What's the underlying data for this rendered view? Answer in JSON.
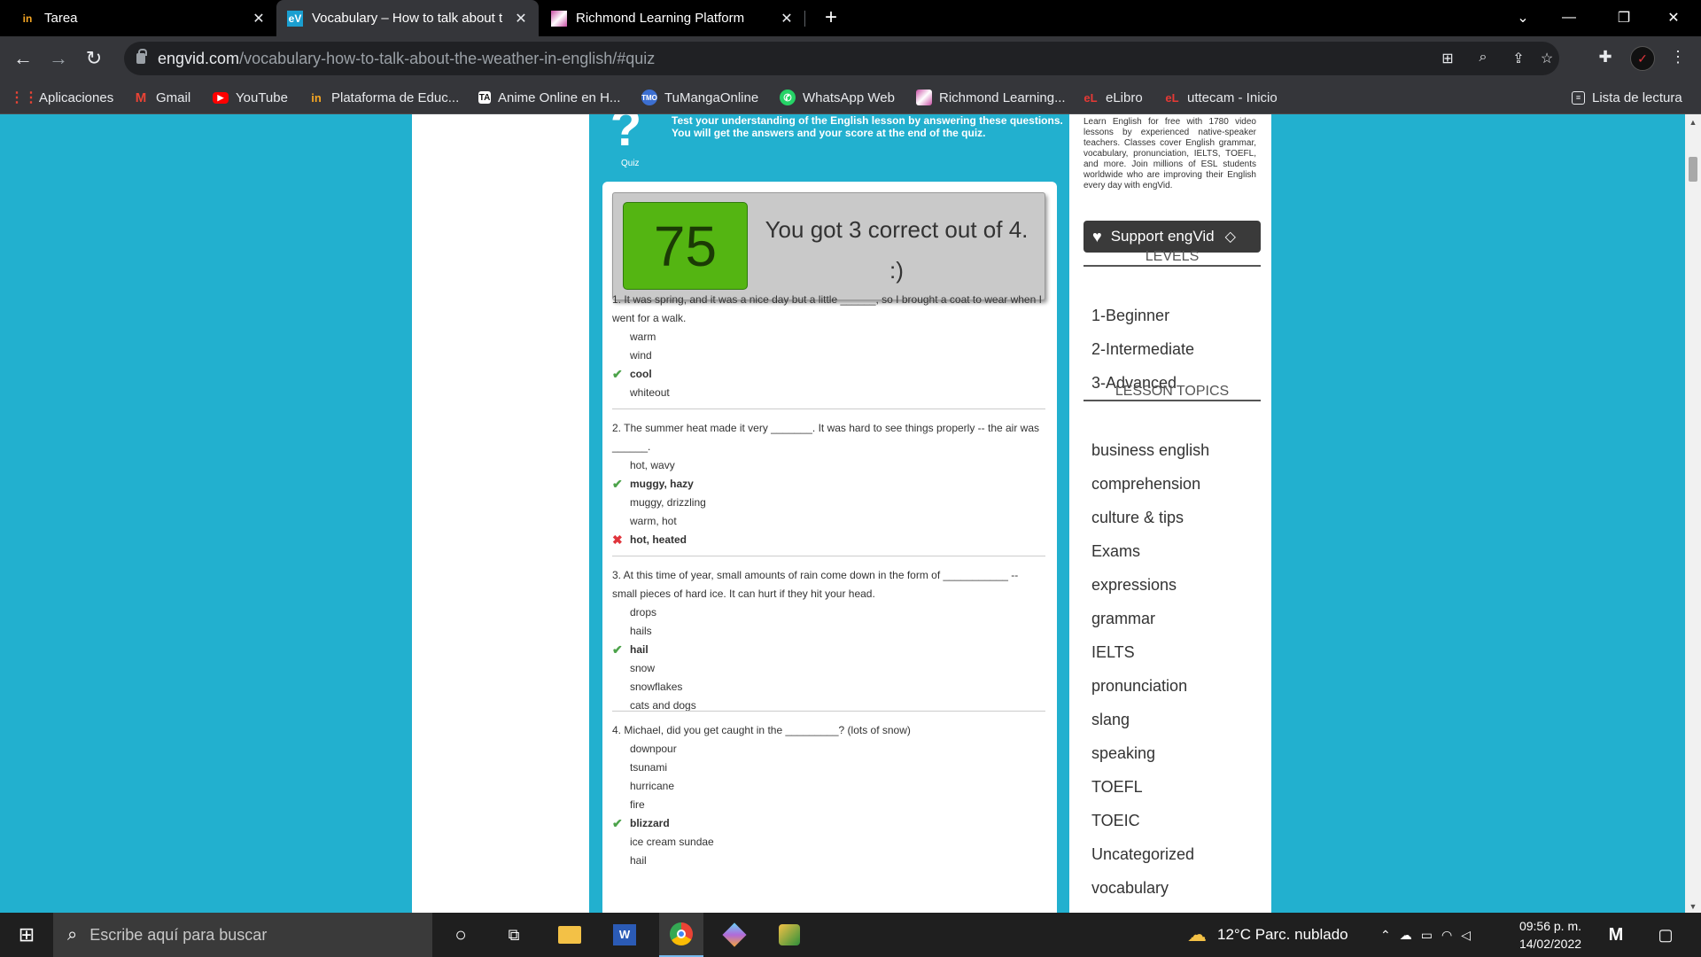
{
  "browser": {
    "tabs": [
      {
        "title": "Tarea",
        "icon": "tarea-favicon",
        "active": false
      },
      {
        "title": "Vocabulary – How to talk about t",
        "icon": "engvid-favicon",
        "active": true
      },
      {
        "title": "Richmond Learning Platform",
        "icon": "richmond-favicon",
        "active": false
      }
    ],
    "url_host": "engvid.com",
    "url_path": "/vocabulary-how-to-talk-about-the-weather-in-english/#quiz",
    "bookmarks": [
      {
        "label": "Aplicaciones",
        "icon": "apps-grid-icon",
        "color": "#ea4335"
      },
      {
        "label": "Gmail",
        "icon": "gmail-icon",
        "color": "#ea4335"
      },
      {
        "label": "YouTube",
        "icon": "youtube-icon",
        "color": "#ff0000"
      },
      {
        "label": "Plataforma de Educ...",
        "icon": "plataforma-icon",
        "color": "#f5a623"
      },
      {
        "label": "Anime Online en H...",
        "icon": "anime-icon",
        "color": "#ffffff"
      },
      {
        "label": "TuMangaOnline",
        "icon": "tumanga-icon",
        "color": "#3c6fd1"
      },
      {
        "label": "WhatsApp Web",
        "icon": "whatsapp-icon",
        "color": "#25d366"
      },
      {
        "label": "Richmond Learning...",
        "icon": "richmond-icon",
        "color": "#c84da4"
      },
      {
        "label": "eLibro",
        "icon": "elibro-icon",
        "color": "#e53935"
      },
      {
        "label": "uttecam - Inicio",
        "icon": "uttecam-icon",
        "color": "#e53935"
      }
    ],
    "reading_list": "Lista de lectura"
  },
  "quiz": {
    "intro": "Test your understanding of the English lesson by answering these questions. You will get the answers and your score at the end of the quiz.",
    "icon_label": "Quiz",
    "score": "75",
    "score_message": "You got 3 correct out of 4. :)",
    "questions": [
      {
        "text": "1. It was spring, and it was a nice day but a little ______, so I brought a coat to wear when I went for a walk.",
        "options": [
          {
            "label": "warm",
            "mark": ""
          },
          {
            "label": "wind",
            "mark": ""
          },
          {
            "label": "cool",
            "mark": "correct"
          },
          {
            "label": "whiteout",
            "mark": ""
          }
        ]
      },
      {
        "text": "2. The summer heat made it very _______. It was hard to see things properly -- the air was ______.",
        "options": [
          {
            "label": "hot, wavy",
            "mark": ""
          },
          {
            "label": "muggy, hazy",
            "mark": "correct"
          },
          {
            "label": "muggy, drizzling",
            "mark": ""
          },
          {
            "label": "warm, hot",
            "mark": ""
          },
          {
            "label": "hot, heated",
            "mark": "wrong"
          }
        ]
      },
      {
        "text": "3. At this time of year, small amounts of rain come down in the form of ___________ -- small pieces of hard ice. It can hurt if they hit your head.",
        "options": [
          {
            "label": "drops",
            "mark": ""
          },
          {
            "label": "hails",
            "mark": ""
          },
          {
            "label": "hail",
            "mark": "correct"
          },
          {
            "label": "snow",
            "mark": ""
          },
          {
            "label": "snowflakes",
            "mark": ""
          },
          {
            "label": "cats and dogs",
            "mark": ""
          }
        ]
      },
      {
        "text": "4. Michael, did you get caught in the _________? (lots of snow)",
        "options": [
          {
            "label": "downpour",
            "mark": ""
          },
          {
            "label": "tsunami",
            "mark": ""
          },
          {
            "label": "hurricane",
            "mark": ""
          },
          {
            "label": "fire",
            "mark": ""
          },
          {
            "label": "blizzard",
            "mark": "correct"
          },
          {
            "label": "ice cream sundae",
            "mark": ""
          },
          {
            "label": "hail",
            "mark": ""
          }
        ]
      }
    ]
  },
  "sidebar": {
    "blurb": "Learn English for free with 1780 video lessons by experienced native-speaker teachers. Classes cover English grammar, vocabulary, pronunciation, IELTS, TOEFL, and more. Join millions of ESL students worldwide who are improving their English every day with engVid.",
    "support_label": "Support engVid",
    "levels_heading": "LEVELS",
    "levels": [
      "1-Beginner",
      "2-Intermediate",
      "3-Advanced"
    ],
    "topics_heading": "LESSON TOPICS",
    "topics": [
      "business english",
      "comprehension",
      "culture & tips",
      "Exams",
      "expressions",
      "grammar",
      "IELTS",
      "pronunciation",
      "slang",
      "speaking",
      "TOEFL",
      "TOEIC",
      "Uncategorized",
      "vocabulary"
    ]
  },
  "taskbar": {
    "search_placeholder": "Escribe aquí para buscar",
    "weather": "12°C  Parc. nublado",
    "time": "09:56 p. m.",
    "date": "14/02/2022"
  },
  "colors": {
    "page_bg": "#22b0cf",
    "score_green": "#54b512",
    "correct": "#4ca34a",
    "wrong": "#e0353c"
  }
}
